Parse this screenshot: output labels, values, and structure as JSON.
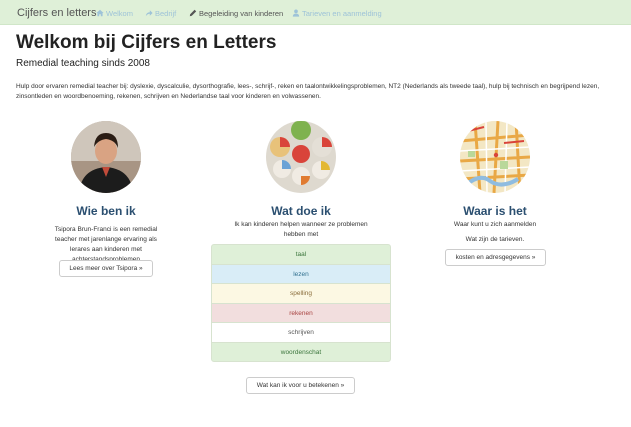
{
  "nav": {
    "brand": "Cijfers en letters",
    "items": [
      {
        "label": "Welkom",
        "icon": "home-icon"
      },
      {
        "label": "Bedrijf",
        "icon": "share-icon"
      },
      {
        "label": "Begeleiding van kinderen",
        "icon": "pencil-icon"
      },
      {
        "label": "Tarieven en aanmelding",
        "icon": "user-icon"
      }
    ],
    "active_index": 2,
    "colors": {
      "bar": "#dff0d8",
      "link": "#9ec3d8",
      "active": "#555555"
    }
  },
  "header": {
    "title": "Welkom bij Cijfers en Letters",
    "subtitle": "Remedial teaching sinds 2008",
    "intro": "Hulp door ervaren remedial teacher bij: dyslexie, dyscalculie, dysorthografie, lees-, schrijf-, reken en taalontwikkelingsproblemen, NT2 (Nederlands als tweede taal), hulp bij technisch en begrijpend lezen, zinsontleden en woordbenoeming, rekenen, schrijven en Nederlandse taal voor kinderen en volwassenen."
  },
  "columns": {
    "who": {
      "title": "Wie ben ik",
      "text": "Tsipora Brun-Franci is een remedial teacher met jarenlange ervaring als lerares aan kinderen met achterstandsproblemen",
      "button": "Lees meer over Tsipora »"
    },
    "what": {
      "title": "Wat doe ik",
      "text": "Ik kan kinderen helpen wanneer ze problemen hebben met",
      "items": [
        {
          "label": "taal",
          "bg": "#dff0d8",
          "fg": "#3c763d"
        },
        {
          "label": "lezen",
          "bg": "#d9edf7",
          "fg": "#31708f"
        },
        {
          "label": "spelling",
          "bg": "#fcf8e3",
          "fg": "#8a6d3b"
        },
        {
          "label": "rekenen",
          "bg": "#f2dede",
          "fg": "#a94442"
        },
        {
          "label": "schrijven",
          "bg": "#ffffff",
          "fg": "#555555"
        },
        {
          "label": "woordenschat",
          "bg": "#dff0d8",
          "fg": "#3c763d"
        }
      ],
      "button": "Wat kan ik voor u betekenen »"
    },
    "where": {
      "title": "Waar is het",
      "text1": "Waar kunt u zich aanmelden",
      "text2": "Wat zijn de tarieven.",
      "button": "kosten en adresgegevens »"
    }
  },
  "title_color": "#2b4f70"
}
